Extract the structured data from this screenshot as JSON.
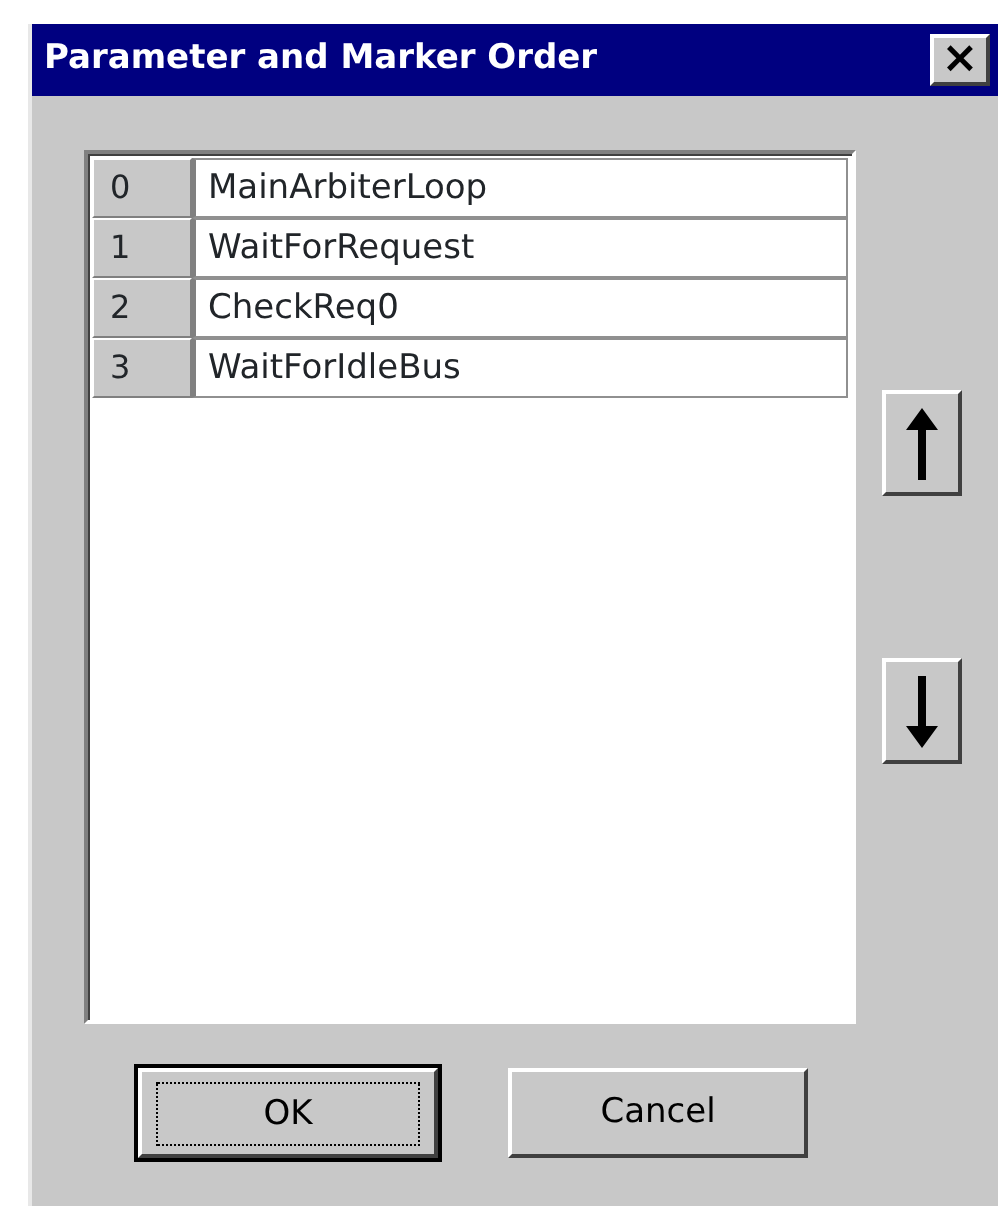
{
  "window": {
    "title": "Parameter and Marker Order",
    "close": "×"
  },
  "list": {
    "rows": [
      {
        "index": "0",
        "name": "MainArbiterLoop"
      },
      {
        "index": "1",
        "name": "WaitForRequest"
      },
      {
        "index": "2",
        "name": "CheckReq0"
      },
      {
        "index": "3",
        "name": "WaitForIdleBus"
      }
    ]
  },
  "buttons": [
    {
      "label": "OK",
      "focused": true
    },
    {
      "label": "Cancel",
      "focused": false
    }
  ]
}
